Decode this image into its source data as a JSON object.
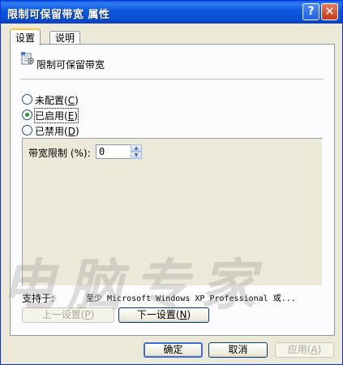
{
  "window": {
    "title": "限制可保留带宽 属性",
    "help_glyph": "?",
    "close_glyph": "✕"
  },
  "tabs": [
    {
      "label": "设置",
      "active": true
    },
    {
      "label": "说明",
      "active": false
    }
  ],
  "policy": {
    "icon": "policy-settings-icon",
    "name": "限制可保留带宽"
  },
  "radios": [
    {
      "label": "未配置(",
      "key": "C",
      "suffix": ")",
      "checked": false
    },
    {
      "label": "已启用(",
      "key": "E",
      "suffix": ")",
      "checked": true
    },
    {
      "label": "已禁用(",
      "key": "D",
      "suffix": ")",
      "checked": false
    }
  ],
  "option": {
    "label": "带宽限制 (%):",
    "value": "0"
  },
  "supported": {
    "label": "支持于:",
    "value": "至少 Microsoft Windows XP Professional 或..."
  },
  "nav": {
    "prev_label": "上一设置(",
    "prev_key": "P",
    "prev_suffix": ")",
    "next_label": "下一设置(",
    "next_key": "N",
    "next_suffix": ")"
  },
  "footer": {
    "ok": "确定",
    "cancel": "取消",
    "apply_label": "应用(",
    "apply_key": "A",
    "apply_suffix": ")"
  },
  "watermark": "电脑专家",
  "colors": {
    "highlight": "#d01010",
    "title_blue": "#0b56de",
    "radio_check": "#21a121"
  }
}
